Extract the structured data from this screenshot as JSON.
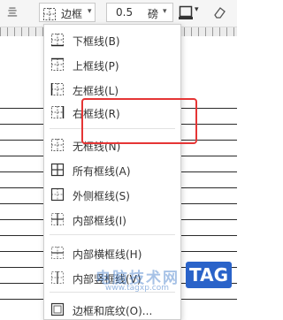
{
  "toolbar": {
    "left_glyph": "亖",
    "border_label": "边框",
    "border_arrow": "▾",
    "weight_value": "0.5",
    "weight_unit": "磅",
    "weight_arrow": "▾",
    "right_icon_arrow": "▾"
  },
  "menu": {
    "items": [
      {
        "label": "下框线(B)",
        "icon": "border-bottom-icon"
      },
      {
        "label": "上框线(P)",
        "icon": "border-top-icon"
      },
      {
        "label": "左框线(L)",
        "icon": "border-left-icon"
      },
      {
        "label": "右框线(R)",
        "icon": "border-right-icon"
      },
      {
        "label": "无框线(N)",
        "icon": "border-none-icon"
      },
      {
        "label": "所有框线(A)",
        "icon": "border-all-icon"
      },
      {
        "label": "外侧框线(S)",
        "icon": "border-outside-icon"
      },
      {
        "label": "内部框线(I)",
        "icon": "border-inside-icon"
      },
      {
        "label": "内部横框线(H)",
        "icon": "border-inside-horizontal-icon"
      },
      {
        "label": "内部竖框线(V)",
        "icon": "border-inside-vertical-icon"
      },
      {
        "label": "边框和底纹(O)...",
        "icon": "border-shading-icon"
      }
    ]
  },
  "highlight_color": "#e53535",
  "watermark": {
    "text": "电脑技术网",
    "subtext": "www.tagxp.com",
    "tag": "TAG"
  }
}
